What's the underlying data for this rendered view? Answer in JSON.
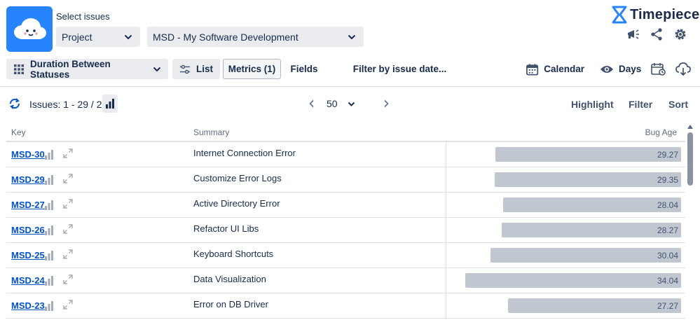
{
  "header": {
    "select_label": "Select issues",
    "project_dropdown": "Project",
    "space_dropdown": "MSD - My Software Development",
    "brand": "Timepiece",
    "icons": [
      "announce-icon",
      "share-icon",
      "gear-icon"
    ]
  },
  "toolbar": {
    "duration_label": "Duration Between Statuses",
    "list_label": "List",
    "metrics_label": "Metrics (1)",
    "fields_label": "Fields",
    "filter_label": "Filter by issue date...",
    "calendar_label": "Calendar",
    "days_label": "Days"
  },
  "issuebar": {
    "count": "Issues: 1 - 29 / 29",
    "page_size": "50",
    "highlight": "Highlight",
    "filter": "Filter",
    "sort": "Sort"
  },
  "table": {
    "columns": {
      "key": "Key",
      "summary": "Summary",
      "bug_age": "Bug Age"
    },
    "bar_max": 34.04,
    "rows": [
      {
        "key": "MSD-30",
        "summary": "Internet Connection Error",
        "value": 29.27,
        "label": "29.27"
      },
      {
        "key": "MSD-29",
        "summary": "Customize Error Logs",
        "value": 29.35,
        "label": "29.35"
      },
      {
        "key": "MSD-27",
        "summary": "Active Directory Error",
        "value": 28.04,
        "label": "28.04"
      },
      {
        "key": "MSD-26",
        "summary": "Refactor UI Libs",
        "value": 28.27,
        "label": "28.27"
      },
      {
        "key": "MSD-25",
        "summary": "Keyboard Shortcuts",
        "value": 30.04,
        "label": "30.04"
      },
      {
        "key": "MSD-24",
        "summary": "Data Visualization",
        "value": 34.04,
        "label": "34.04"
      },
      {
        "key": "MSD-23",
        "summary": "Error on DB Driver",
        "value": 27.27,
        "label": "27.27"
      }
    ]
  },
  "colors": {
    "accent": "#0052cc",
    "logo_bg": "#2684ff",
    "bar": "#c1c7d0",
    "button_bg": "#ebecf0"
  }
}
